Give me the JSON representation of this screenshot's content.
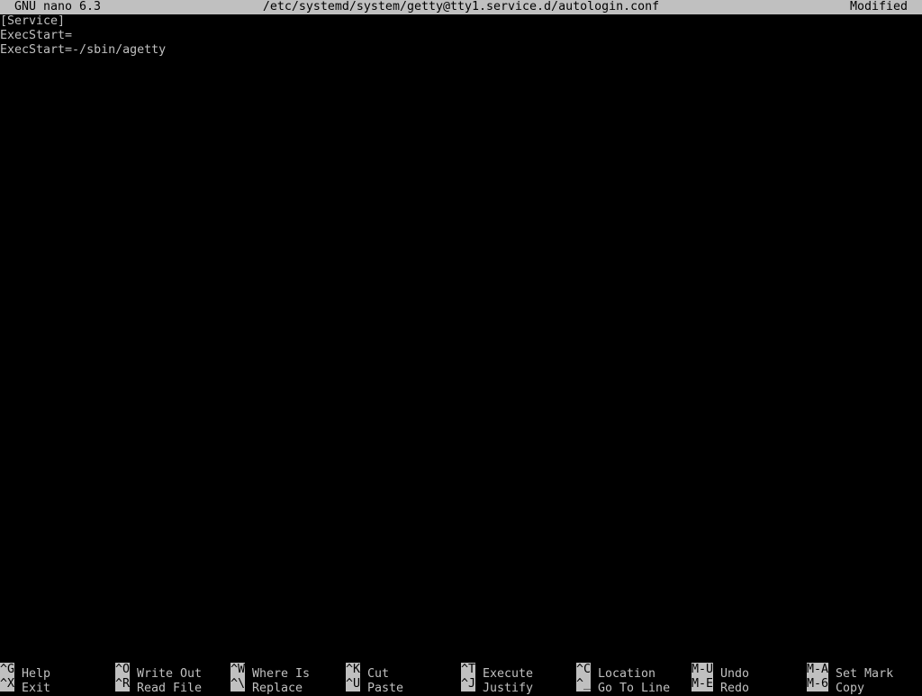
{
  "titlebar": {
    "app": "GNU nano 6.3",
    "path": "/etc/systemd/system/getty@tty1.service.d/autologin.conf",
    "state": "Modified"
  },
  "editor": {
    "lines": [
      "[Service]",
      "ExecStart=",
      "ExecStart=-/sbin/agetty"
    ]
  },
  "shortcuts": {
    "row1": [
      {
        "key": "^G",
        "label": "Help"
      },
      {
        "key": "^O",
        "label": "Write Out"
      },
      {
        "key": "^W",
        "label": "Where Is"
      },
      {
        "key": "^K",
        "label": "Cut"
      },
      {
        "key": "^T",
        "label": "Execute"
      },
      {
        "key": "^C",
        "label": "Location"
      },
      {
        "key": "M-U",
        "label": "Undo"
      },
      {
        "key": "M-A",
        "label": "Set Mark"
      }
    ],
    "row2": [
      {
        "key": "^X",
        "label": "Exit"
      },
      {
        "key": "^R",
        "label": "Read File"
      },
      {
        "key": "^\\",
        "label": "Replace"
      },
      {
        "key": "^U",
        "label": "Paste"
      },
      {
        "key": "^J",
        "label": "Justify"
      },
      {
        "key": "^_",
        "label": "Go To Line"
      },
      {
        "key": "M-E",
        "label": "Redo"
      },
      {
        "key": "M-6",
        "label": "Copy"
      }
    ]
  },
  "colors": {
    "background": "#000000",
    "foreground": "#c0c0c0",
    "inverse_bg": "#c0c0c0",
    "inverse_fg": "#000000"
  }
}
